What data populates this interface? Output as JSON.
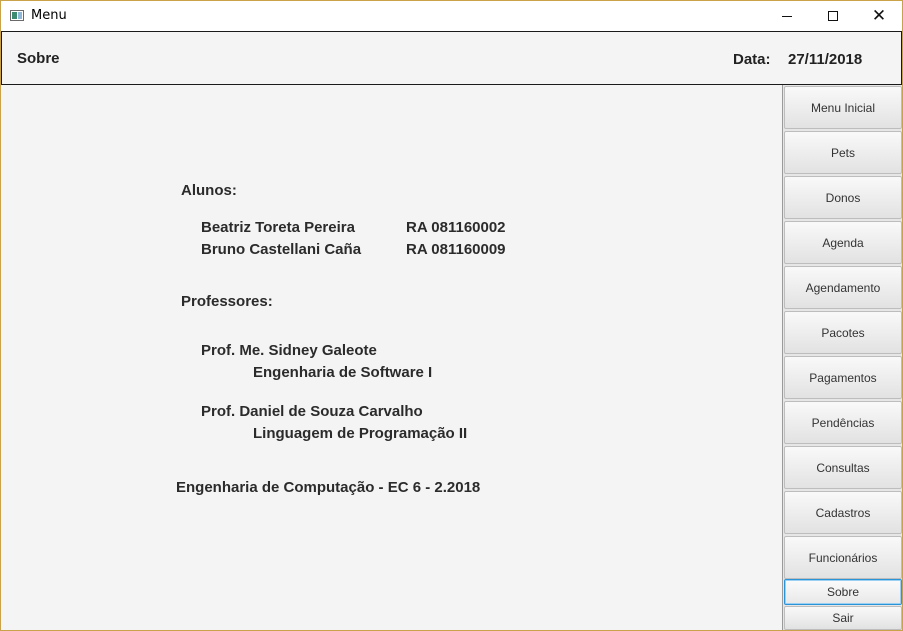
{
  "window": {
    "title": "Menu"
  },
  "header": {
    "title": "Sobre",
    "date_label": "Data:",
    "date_value": "27/11/2018"
  },
  "about": {
    "students_heading": "Alunos:",
    "students": [
      {
        "name": "Beatriz Toreta Pereira",
        "ra": "RA 081160002"
      },
      {
        "name": "Bruno Castellani Caña",
        "ra": "RA 081160009"
      }
    ],
    "professors_heading": "Professores:",
    "professors": [
      {
        "name": "Prof. Me. Sidney Galeote",
        "subject": "Engenharia de Software I"
      },
      {
        "name": "Prof. Daniel de Souza Carvalho",
        "subject": "Linguagem de Programação II"
      }
    ],
    "course": "Engenharia de Computação - EC 6 - 2.2018"
  },
  "sidebar": {
    "items": [
      {
        "label": "Menu Inicial"
      },
      {
        "label": "Pets"
      },
      {
        "label": "Donos"
      },
      {
        "label": "Agenda"
      },
      {
        "label": "Agendamento"
      },
      {
        "label": "Pacotes"
      },
      {
        "label": "Pagamentos"
      },
      {
        "label": "Pendências"
      },
      {
        "label": "Consultas"
      },
      {
        "label": "Cadastros"
      },
      {
        "label": "Funcionários"
      },
      {
        "label": "Sobre",
        "active": true
      },
      {
        "label": "Sair"
      }
    ]
  },
  "colors": {
    "accent_focus": "#2b93d8",
    "window_border": "#c9a24a"
  }
}
